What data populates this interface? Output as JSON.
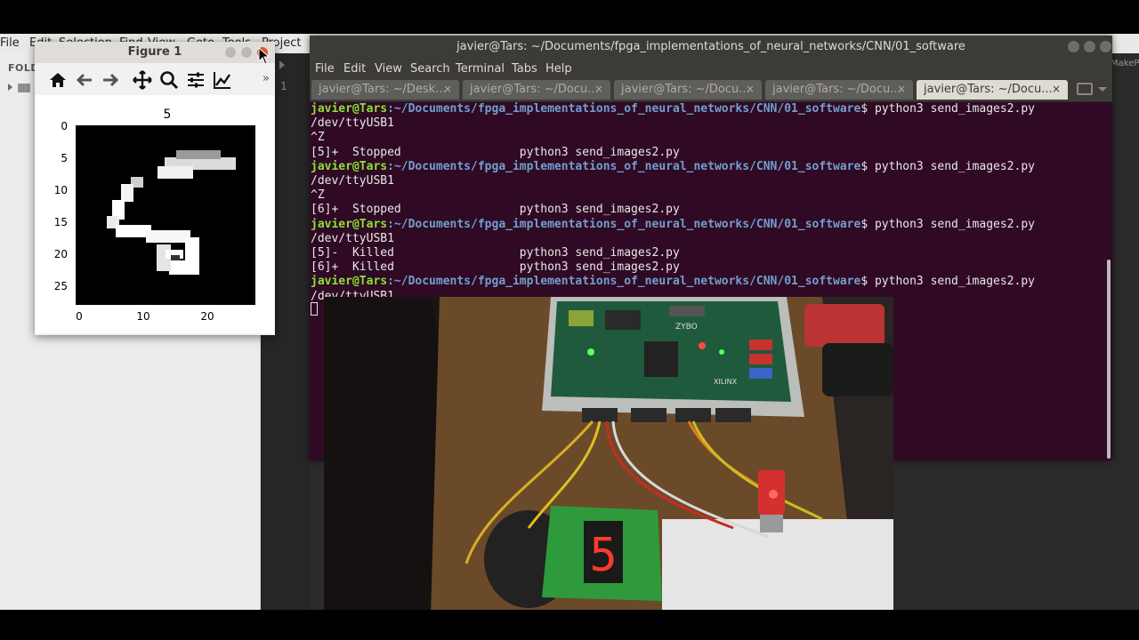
{
  "editor": {
    "menu": [
      "File",
      "Edit",
      "Selection",
      "Find",
      "View",
      "Goto",
      "Tools",
      "Project"
    ],
    "sidebar_header": "FOLDERS",
    "gutter_line": "1",
    "right_tab_label": "MakePh"
  },
  "terminal": {
    "title": "javier@Tars: ~/Documents/fpga_implementations_of_neural_networks/CNN/01_software",
    "menu": [
      "File",
      "Edit",
      "View",
      "Search",
      "Terminal",
      "Tabs",
      "Help"
    ],
    "tabs": [
      {
        "label": "javier@Tars: ~/Desk...",
        "active": false
      },
      {
        "label": "javier@Tars: ~/Docu...",
        "active": false
      },
      {
        "label": "javier@Tars: ~/Docu...",
        "active": false
      },
      {
        "label": "javier@Tars: ~/Docu...",
        "active": false
      },
      {
        "label": "javier@Tars: ~/Docu...",
        "active": true
      }
    ],
    "tab_close_glyph": "×",
    "prompt_user": "javier@Tars",
    "prompt_path": ":~/Documents/fpga_implementations_of_neural_networks/CNN/01_software",
    "command": "$ python3 send_images2.py",
    "output": {
      "device": "/dev/ttyUSB1",
      "ctrl_z": "^Z",
      "job5_stopped": "[5]+  Stopped                 python3 send_images2.py",
      "job6_stopped": "[6]+  Stopped                 python3 send_images2.py",
      "job5_killed": "[5]-  Killed                  python3 send_images2.py",
      "job6_killed": "[6]+  Killed                  python3 send_images2.py"
    }
  },
  "figure": {
    "title": "Figure 1",
    "overflow": "»",
    "toolbar": [
      "home-icon",
      "back-icon",
      "forward-icon",
      "pan-icon",
      "zoom-icon",
      "configure-icon",
      "edit-axes-icon"
    ],
    "plot_title": "5",
    "y_ticks": [
      "0",
      "5",
      "10",
      "15",
      "20",
      "25"
    ],
    "x_ticks": [
      "0",
      "10",
      "20"
    ]
  },
  "photo": {
    "board_label": "ZYBO",
    "board_brand": "XILINX",
    "display_digit": "5"
  },
  "colors": {
    "terminal_bg": "#300a24",
    "prompt_user": "#8ae234",
    "prompt_path": "#729fcf",
    "segment_red": "#ff3a2a"
  }
}
